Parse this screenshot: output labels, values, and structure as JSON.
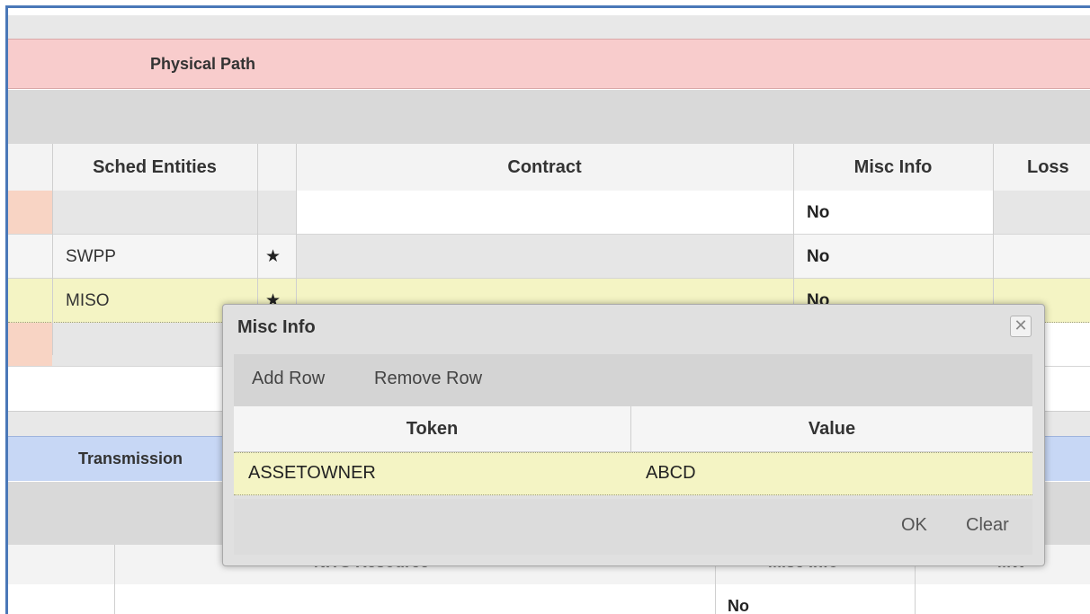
{
  "physical_path": {
    "title": "Physical Path"
  },
  "table": {
    "headers": {
      "sched_entities": "Sched Entities",
      "contract": "Contract",
      "misc_info": "Misc Info",
      "loss": "Loss"
    },
    "rows": [
      {
        "entity": "",
        "star": "",
        "misc": "No"
      },
      {
        "entity": "SWPP",
        "star": "★",
        "misc": "No"
      },
      {
        "entity": "MISO",
        "star": "★",
        "misc": "No"
      },
      {
        "entity": "",
        "star": "",
        "misc": ""
      }
    ]
  },
  "transmission": {
    "title": "Transmission",
    "col_resource": "NITS Resource",
    "col_misc": "Misc Info",
    "col_mw": "MW",
    "first_value": "No"
  },
  "dialog": {
    "title": "Misc Info",
    "close_glyph": "✕",
    "toolbar": {
      "add_row": "Add Row",
      "remove_row": "Remove Row"
    },
    "columns": {
      "token": "Token",
      "value": "Value"
    },
    "rows": [
      {
        "token": "ASSETOWNER",
        "value": "ABCD"
      }
    ],
    "footer": {
      "ok": "OK",
      "clear": "Clear"
    }
  },
  "colors": {
    "physical_bar": "#f8cccc",
    "transmission_bar": "#c7d7f5",
    "selected_row": "#f4f4c4",
    "frame_border": "#4a78b8"
  }
}
